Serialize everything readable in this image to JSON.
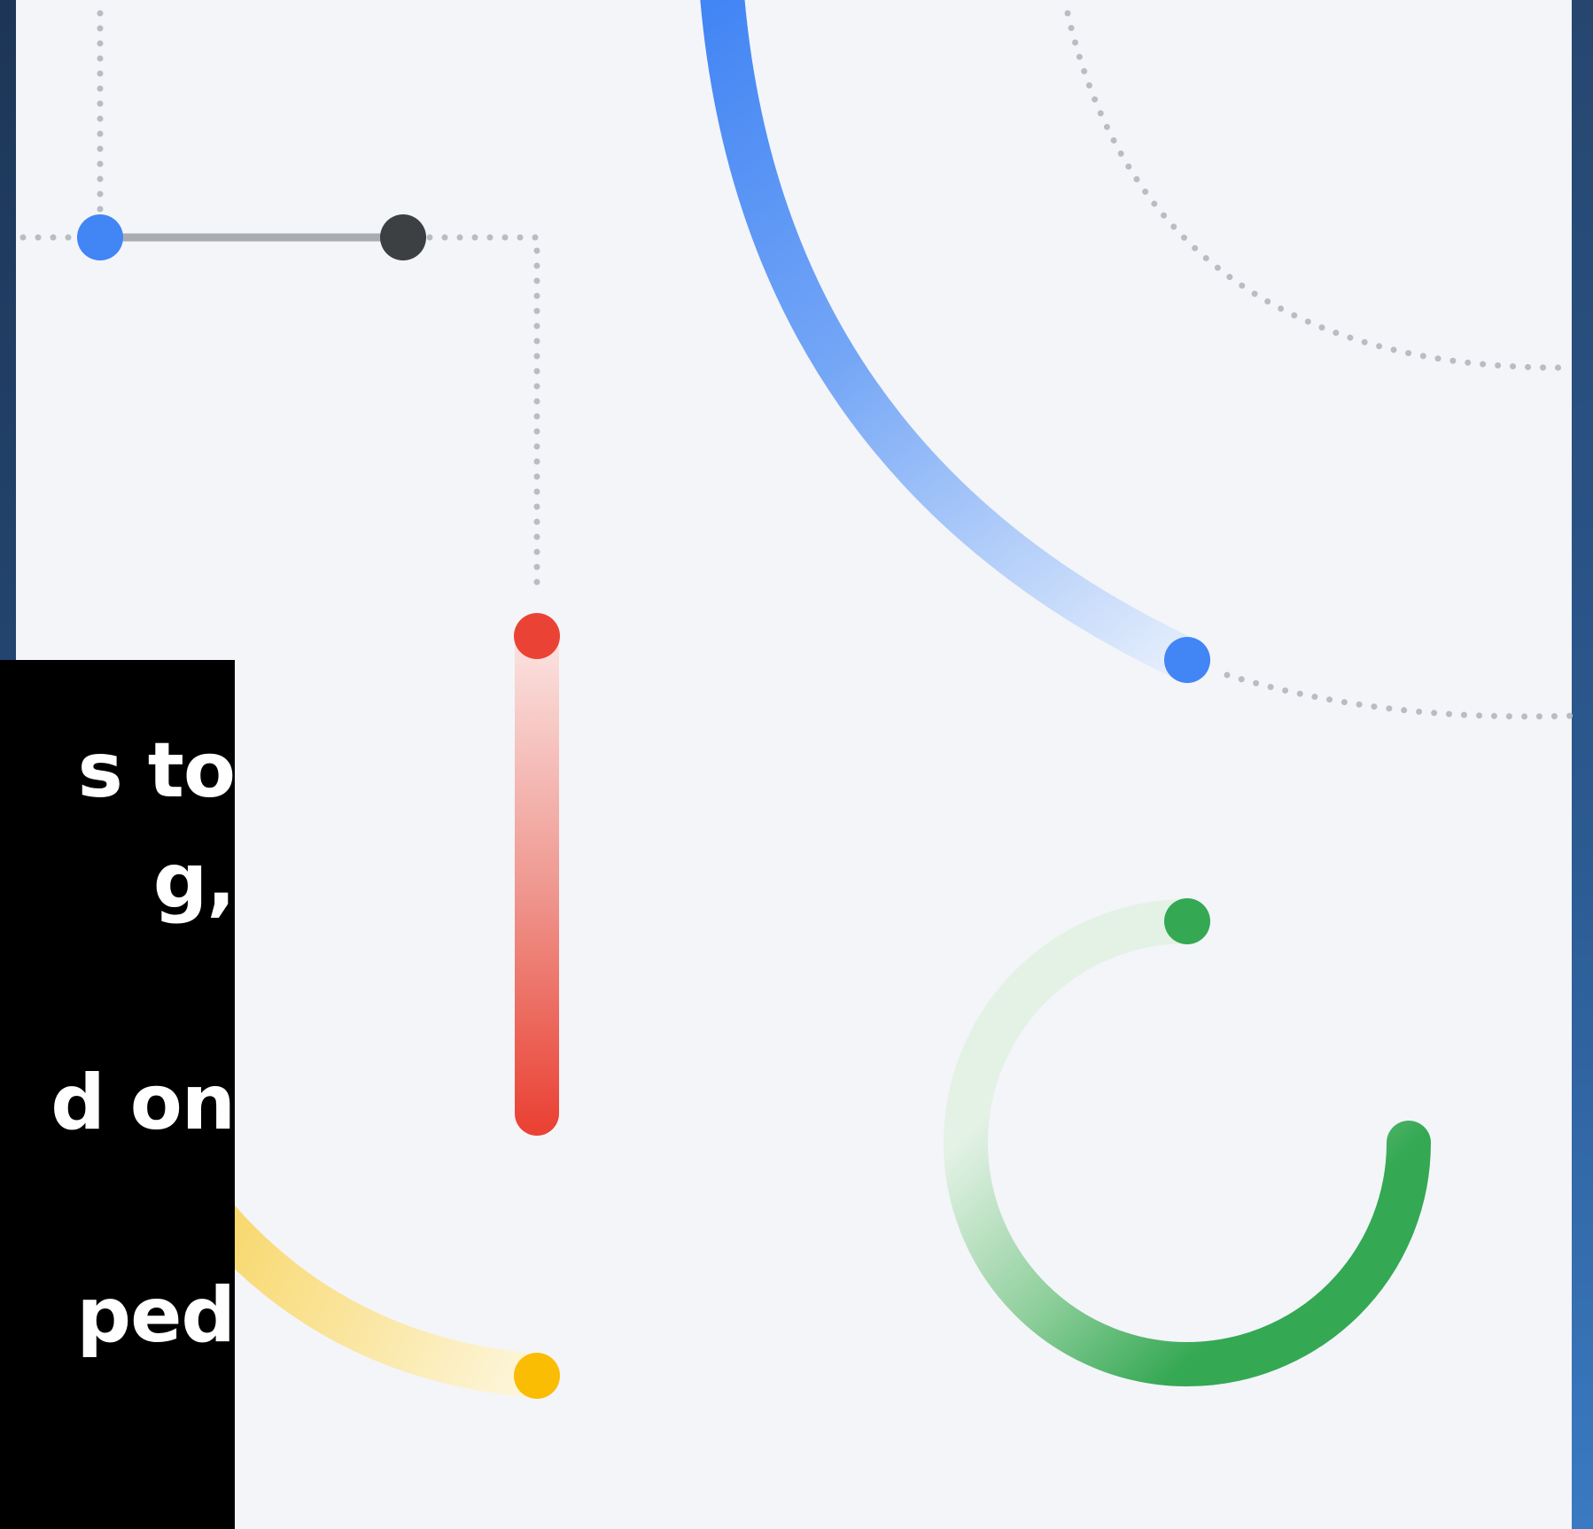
{
  "caption": {
    "lines": [
      "s to",
      "g,",
      "d on",
      "ped"
    ]
  },
  "colors": {
    "blue": "#4285f4",
    "red": "#ea4335",
    "yellow": "#fbbc04",
    "green": "#34a853",
    "dark": "#3c4043",
    "dots": "#b9bdc3",
    "panel": "#f3f5f9"
  }
}
